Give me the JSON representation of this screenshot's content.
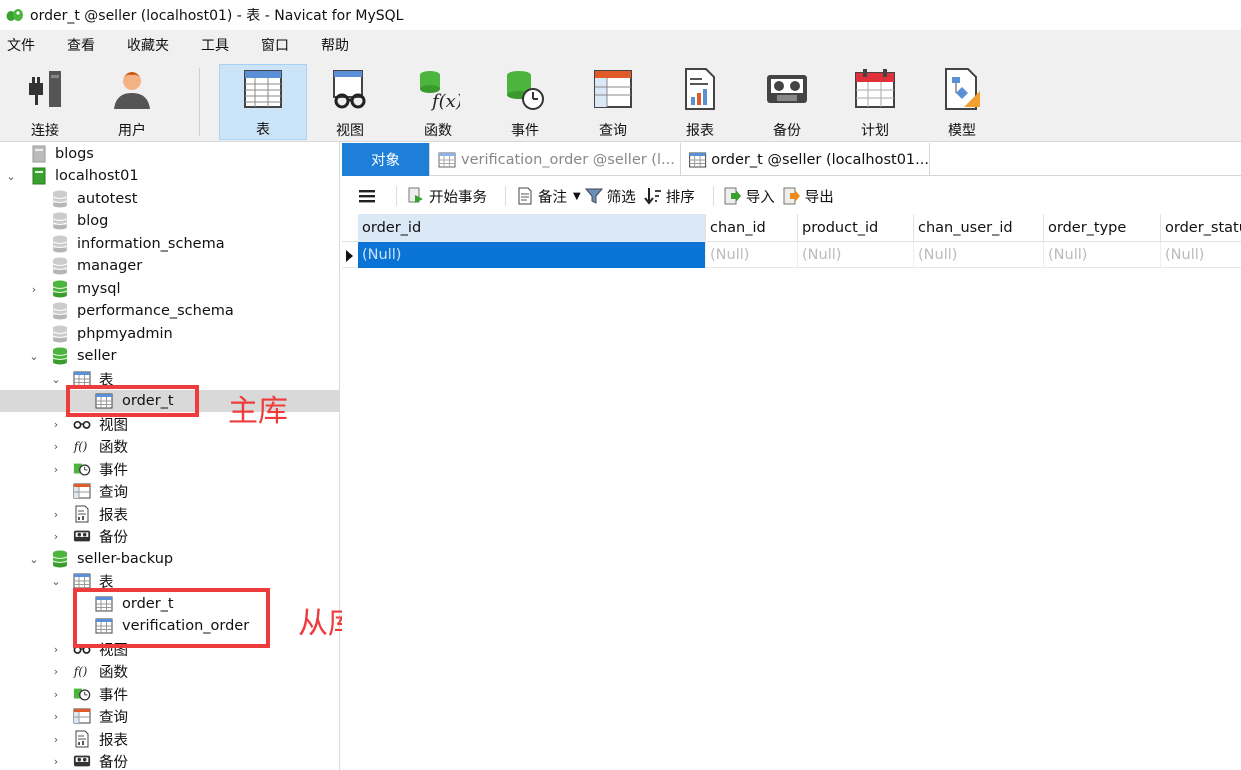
{
  "window": {
    "title": "order_t @seller (localhost01) - 表 - Navicat for MySQL"
  },
  "menu": [
    "文件",
    "查看",
    "收藏夹",
    "工具",
    "窗口",
    "帮助"
  ],
  "toolbar": {
    "buttons": [
      {
        "label": "连接",
        "icon": "connection-icon"
      },
      {
        "label": "用户",
        "icon": "user-icon"
      },
      {
        "label": "表",
        "icon": "table-icon",
        "active": true
      },
      {
        "label": "视图",
        "icon": "view-icon"
      },
      {
        "label": "函数",
        "icon": "function-icon"
      },
      {
        "label": "事件",
        "icon": "event-icon"
      },
      {
        "label": "查询",
        "icon": "query-icon"
      },
      {
        "label": "报表",
        "icon": "report-icon"
      },
      {
        "label": "备份",
        "icon": "backup-icon"
      },
      {
        "label": "计划",
        "icon": "schedule-icon"
      },
      {
        "label": "模型",
        "icon": "model-icon"
      }
    ]
  },
  "tree": {
    "items": [
      {
        "label": "blogs",
        "icon": "server-gray-icon"
      },
      {
        "label": "localhost01",
        "icon": "server-green-icon",
        "expanded": true
      },
      {
        "label": "autotest",
        "icon": "database-gray-icon"
      },
      {
        "label": "blog",
        "icon": "database-gray-icon"
      },
      {
        "label": "information_schema",
        "icon": "database-gray-icon"
      },
      {
        "label": "manager",
        "icon": "database-gray-icon"
      },
      {
        "label": "mysql",
        "icon": "database-green-icon"
      },
      {
        "label": "performance_schema",
        "icon": "database-gray-icon"
      },
      {
        "label": "phpmyadmin",
        "icon": "database-gray-icon"
      },
      {
        "label": "seller",
        "icon": "database-green-icon",
        "expanded": true
      },
      {
        "label": "表",
        "icon": "table-icon",
        "expanded": true
      },
      {
        "label": "order_t",
        "icon": "table-icon",
        "selected": true
      },
      {
        "label": "视图",
        "icon": "view-icon"
      },
      {
        "label": "函数",
        "icon": "function-icon"
      },
      {
        "label": "事件",
        "icon": "event-icon"
      },
      {
        "label": "查询",
        "icon": "query-icon"
      },
      {
        "label": "报表",
        "icon": "report-icon"
      },
      {
        "label": "备份",
        "icon": "backup-icon"
      },
      {
        "label": "seller-backup",
        "icon": "database-green-icon",
        "expanded": true
      },
      {
        "label": "表",
        "icon": "table-icon",
        "expanded": true
      },
      {
        "label": "order_t",
        "icon": "table-icon"
      },
      {
        "label": "verification_order",
        "icon": "table-icon"
      },
      {
        "label": "视图",
        "icon": "view-icon"
      },
      {
        "label": "函数",
        "icon": "function-icon"
      },
      {
        "label": "事件",
        "icon": "event-icon"
      },
      {
        "label": "查询",
        "icon": "query-icon"
      },
      {
        "label": "报表",
        "icon": "report-icon"
      },
      {
        "label": "备份",
        "icon": "backup-icon"
      }
    ]
  },
  "annotations": {
    "master": "主库",
    "slave": "从库",
    "color": "#ee3b3b"
  },
  "tabs": [
    {
      "label": "对象"
    },
    {
      "label": "verification_order @seller (l..."
    },
    {
      "label": "order_t @seller (localhost01..."
    }
  ],
  "subtoolbar": {
    "menu_icon": "hamburger-icon",
    "begin_transaction": "开始事务",
    "memo": "备注",
    "filter": "筛选",
    "sort": "排序",
    "import": "导入",
    "export": "导出"
  },
  "grid": {
    "columns": [
      "order_id",
      "chan_id",
      "product_id",
      "chan_user_id",
      "order_type",
      "order_statu"
    ],
    "rows": [
      [
        "(Null)",
        "(Null)",
        "(Null)",
        "(Null)",
        "(Null)",
        "(Null)"
      ]
    ]
  },
  "colors": {
    "accent": "#1e7fd8",
    "selection": "#0a73d6",
    "toolbar_active": "#cce4f7"
  }
}
